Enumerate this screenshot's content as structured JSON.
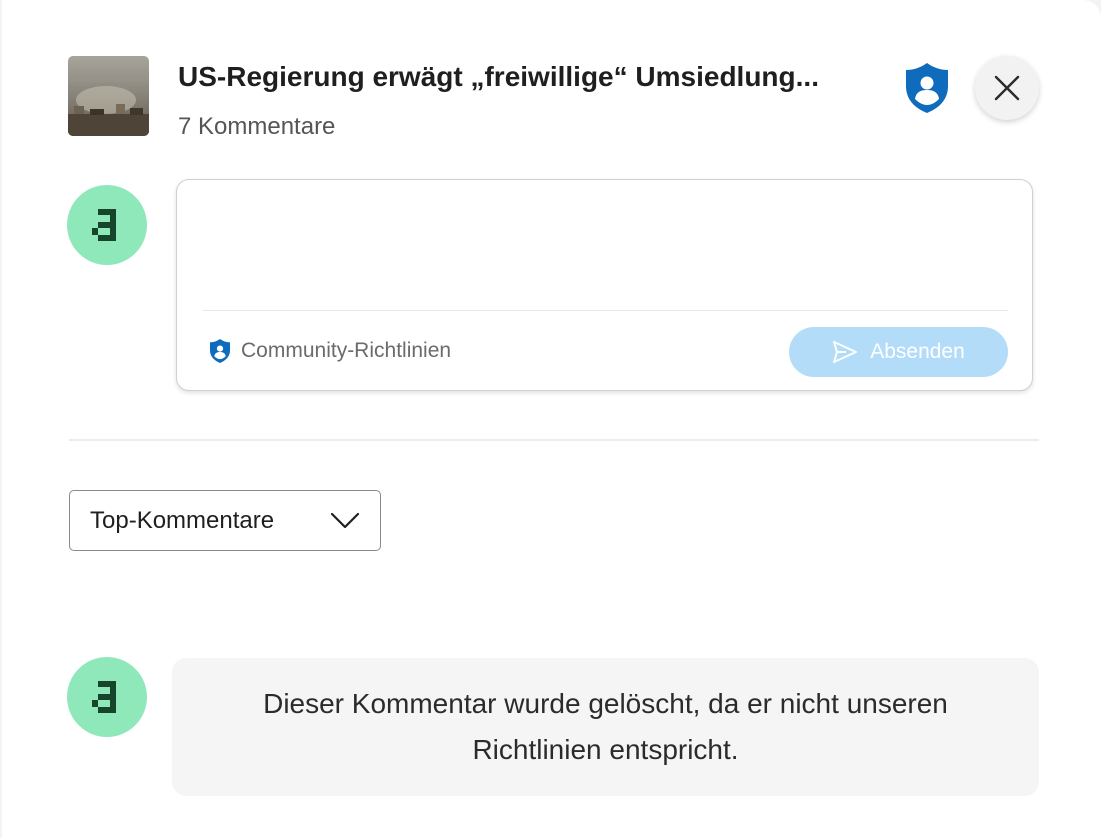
{
  "article": {
    "title": "US-Regierung erwägt „freiwillige“ Umsiedlung...",
    "comment_count": "7 Kommentare"
  },
  "composer": {
    "placeholder": "",
    "guidelines_label": "Community-Richtlinien",
    "send_label": "Absenden"
  },
  "sort": {
    "selected": "Top-Kommentare"
  },
  "comments": [
    {
      "text": "Dieser Kommentar wurde gelöscht, da er nicht unseren Richtlinien entspricht."
    }
  ],
  "colors": {
    "accent": "#0f6cbd",
    "avatar_bg": "#8fe8b9",
    "avatar_glyph": "#17452b",
    "send_disabled": "#b3dcf8"
  },
  "icons": {
    "badge": "shield-person-icon",
    "close": "close-icon",
    "guidelines": "shield-person-icon",
    "send": "send-icon",
    "sort": "chevron-down-icon",
    "avatar": "pixel-a-avatar"
  }
}
